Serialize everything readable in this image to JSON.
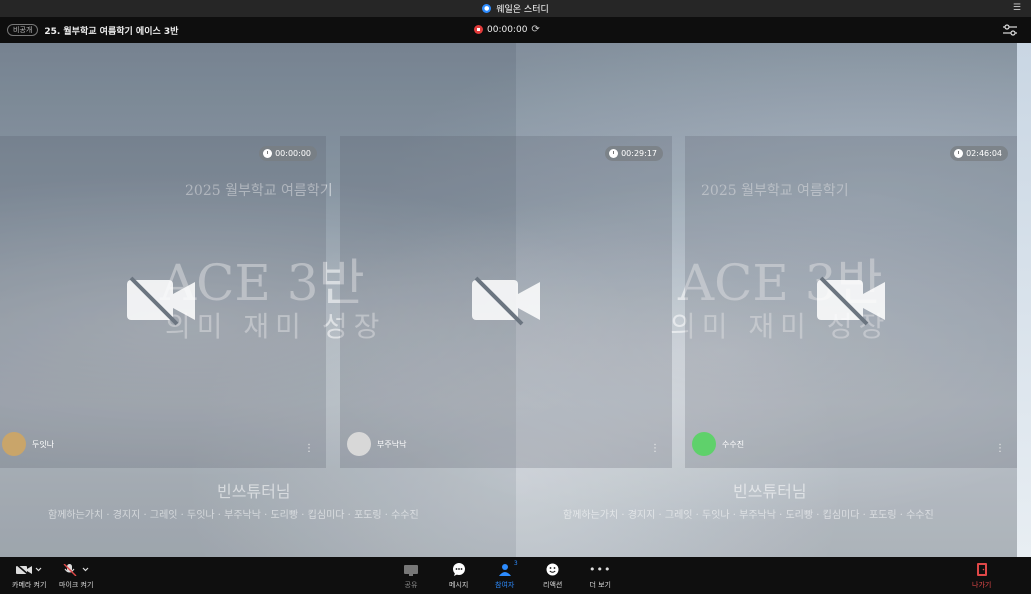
{
  "window": {
    "app_title": "웨일온 스터디"
  },
  "meeting": {
    "visibility_badge": "비공개",
    "title": "25. 월부학교 여름학기 에이스 3반",
    "timer": "00:00:00"
  },
  "slide_background": {
    "year_title": "2025 월부학교 여름학기",
    "class_title": "ACE 3반",
    "motto": "의미 재미 성장",
    "tutor": "빈쓰튜터님",
    "members": "함께하는가치 · 경지지 · 그레잇 · 두잇나 · 부주낙낙 · 도리빵 · 킵심미다 · 포도링 · 수수진"
  },
  "participants": [
    {
      "name": "두잇나",
      "time": "00:00:00",
      "avatar_color": "#c9a56a",
      "camera": "off"
    },
    {
      "name": "부주낙낙",
      "time": "00:29:17",
      "avatar_color": "#d8d8d8",
      "camera": "off"
    },
    {
      "name": "수수진",
      "time": "02:46:04",
      "avatar_color": "#5fd16b",
      "camera": "off"
    }
  ],
  "toolbar": {
    "camera_label": "카메라 켜기",
    "mic_label": "마이크 켜기",
    "share_label": "공유",
    "message_label": "메시지",
    "participants_label": "참여자",
    "participants_count": "3",
    "reaction_label": "리액션",
    "more_label": "더 보기",
    "leave_label": "나가기"
  },
  "colors": {
    "accent": "#2d8cff",
    "danger": "#e04848",
    "recording": "#e23b3b"
  }
}
